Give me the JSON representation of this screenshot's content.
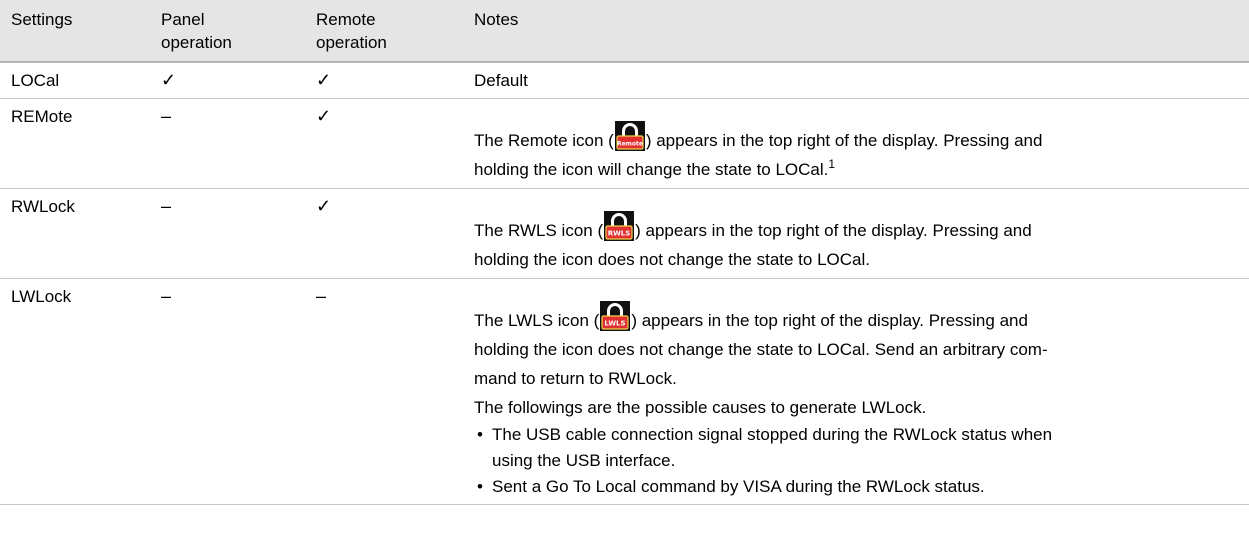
{
  "table": {
    "headers": [
      "Settings",
      "Panel operation",
      "Remote operation",
      "Notes"
    ],
    "header_lines": [
      [
        "Settings"
      ],
      [
        "Panel",
        "operation"
      ],
      [
        "Remote",
        "operation"
      ],
      [
        "Notes"
      ]
    ],
    "rows": [
      {
        "setting": "LOCal",
        "panel": "✓",
        "remote": "✓",
        "notes": "Default"
      },
      {
        "setting": "REMote",
        "panel": "–",
        "remote": "✓",
        "icon_name": "remote-lock-icon",
        "icon_label": "Remote",
        "icon_color": "#e03030",
        "notes_before": "The Remote icon (",
        "notes_after": ") appears in the top right of the display. Pressing and",
        "notes_line2": "holding the icon will change the state to LOCal.",
        "footnote": "1"
      },
      {
        "setting": "RWLock",
        "panel": "–",
        "remote": "✓",
        "icon_name": "rwls-lock-icon",
        "icon_label": "RWLS",
        "icon_color": "#e03030",
        "notes_before": "The RWLS icon (",
        "notes_after": ") appears in the top right of the display. Pressing and",
        "notes_line2": "holding the icon does not change the state to LOCal."
      },
      {
        "setting": "LWLock",
        "panel": "–",
        "remote": "–",
        "icon_name": "lwls-lock-icon",
        "icon_label": "LWLS",
        "icon_color": "#e03030",
        "notes_before": "The LWLS icon (",
        "notes_after": ") appears in the top right of the display. Pressing and",
        "notes_line2": "holding the icon does not change the state to LOCal. Send an arbitrary com-",
        "notes_line3": "mand to return to RWLock.",
        "notes_line4": "The followings are the possible causes to generate LWLock.",
        "bullets": [
          [
            "The USB cable connection signal stopped during the RWLock status when",
            "using the USB interface."
          ],
          [
            "Sent a Go To Local command by VISA during the RWLock status."
          ]
        ]
      }
    ]
  }
}
